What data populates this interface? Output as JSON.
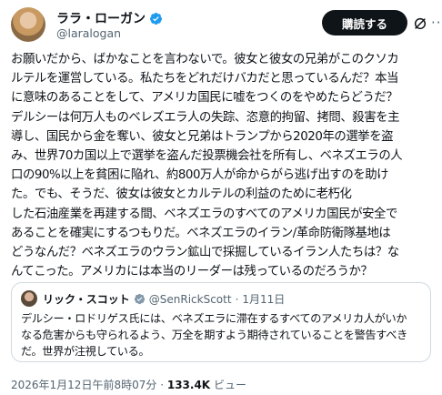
{
  "author": {
    "name": "ララ・ローガン",
    "handle": "@laralogan",
    "verified_color": "#1d9bf0"
  },
  "actions": {
    "subscribe_label": "購読する",
    "grok_icon": "grok-icon",
    "more_icon": "more-icon"
  },
  "tweet": {
    "text": "お願いだから、ばかなことを言わないで。彼女と彼女の兄弟がこのクソカ\nルテルを運営している。私たちをどれだけバカだと思っているんだ？本当\nに意味のあることをして、アメリカ国民に嘘をつくのをやめたらどうだ？\nデルシーは何万人ものベレズエラ人の失踪、恣意的拘留、拷問、殺害を主\n導し、国民から金を奪い、彼女と兄弟はトランプから2020年の選挙を盗\nみ、世界70カ国以上で選挙を盗んだ投票機会社を所有し、ベネズエラの人\n口の90%以上を貧困に陥れ、約800万人が命からがら逃げ出すのを助け\nた。でも、そうだ、彼女は彼女とカルテルの利益のために老朽化\nした石油産業を再建する間、ベネズエラのすべてのアメリカ国民が安全で\nあることを確実にするつもりだ。ベネズエラのイラン/革命防衛隊基地は\nどうなんだ？ベネズエラのウラン鉱山で採掘しているイラン人たちは？な\nんてこった。アメリカには本当のリーダーは残っているのだろうか？"
  },
  "quote": {
    "name": "リック・スコット",
    "handle": "@SenRickScott",
    "dot": "·",
    "date": "1月11日",
    "text": "デルシー・ロドリゲス氏には、ベネズエラに滞在するすべてのアメリカ人がいか\nなる危害からも守られるよう、万全を期すよう期待されていることを警告すべき\nだ。世界が注視している。",
    "verified_color": "#829aab"
  },
  "meta": {
    "timestamp": "2026年1月12日午前8時07分",
    "separator": "·",
    "views_count": "133.4K",
    "views_label": "ビュー"
  }
}
